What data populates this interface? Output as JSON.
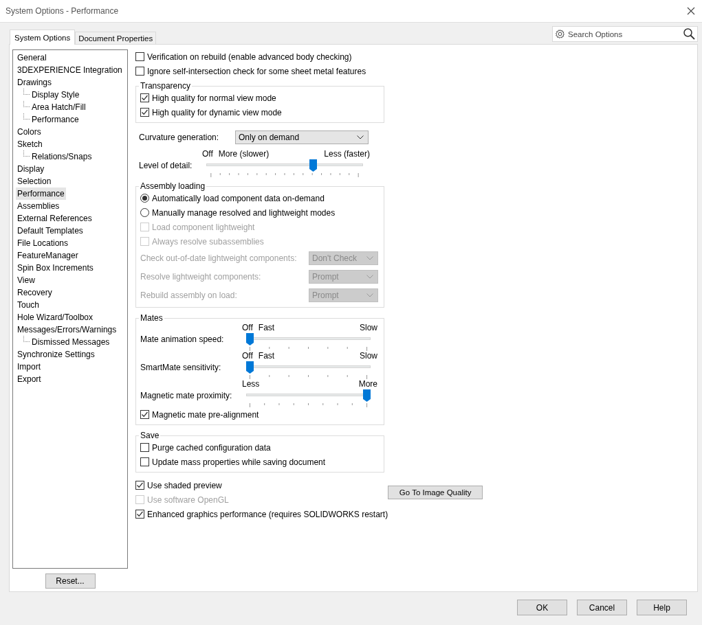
{
  "window": {
    "title": "System Options - Performance"
  },
  "tabs": [
    {
      "label": "System Options",
      "selected": true
    },
    {
      "label": "Document Properties",
      "selected": false
    }
  ],
  "search": {
    "placeholder": "Search Options"
  },
  "sidebar": {
    "items": [
      {
        "label": "General",
        "selected": false
      },
      {
        "label": "3DEXPERIENCE Integration",
        "selected": false
      },
      {
        "label": "Drawings",
        "selected": false,
        "children": [
          {
            "label": "Display Style",
            "selected": false
          },
          {
            "label": "Area Hatch/Fill",
            "selected": false
          },
          {
            "label": "Performance",
            "selected": false
          }
        ]
      },
      {
        "label": "Colors",
        "selected": false
      },
      {
        "label": "Sketch",
        "selected": false,
        "children": [
          {
            "label": "Relations/Snaps",
            "selected": false
          }
        ]
      },
      {
        "label": "Display",
        "selected": false
      },
      {
        "label": "Selection",
        "selected": false
      },
      {
        "label": "Performance",
        "selected": true
      },
      {
        "label": "Assemblies",
        "selected": false
      },
      {
        "label": "External References",
        "selected": false
      },
      {
        "label": "Default Templates",
        "selected": false
      },
      {
        "label": "File Locations",
        "selected": false
      },
      {
        "label": "FeatureManager",
        "selected": false
      },
      {
        "label": "Spin Box Increments",
        "selected": false
      },
      {
        "label": "View",
        "selected": false
      },
      {
        "label": "Recovery",
        "selected": false
      },
      {
        "label": "Touch",
        "selected": false
      },
      {
        "label": "Hole Wizard/Toolbox",
        "selected": false
      },
      {
        "label": "Messages/Errors/Warnings",
        "selected": false,
        "children": [
          {
            "label": "Dismissed Messages",
            "selected": false
          }
        ]
      },
      {
        "label": "Synchronize Settings",
        "selected": false
      },
      {
        "label": "Import",
        "selected": false
      },
      {
        "label": "Export",
        "selected": false
      }
    ],
    "reset_button": "Reset..."
  },
  "content": [
    {
      "kind": "checkbox",
      "label": "Verification on rebuild (enable advanced body checking)",
      "checked": false,
      "disabled": false
    },
    {
      "kind": "checkbox",
      "label": "Ignore self-intersection check for some sheet metal features",
      "checked": false,
      "disabled": false
    },
    {
      "kind": "group",
      "title": "Transparency",
      "items": [
        {
          "kind": "checkbox",
          "label": "High quality for normal view mode",
          "checked": true,
          "disabled": false
        },
        {
          "kind": "checkbox",
          "label": "High quality for dynamic view mode",
          "checked": true,
          "disabled": false
        }
      ]
    },
    {
      "kind": "dropdown",
      "label": "Curvature generation:",
      "value": "Only on demand",
      "disabled": false
    },
    {
      "kind": "slider",
      "label": "Level of detail:",
      "scale": [
        "Off",
        "More (slower)",
        "Less (faster)"
      ],
      "level": 0.69
    },
    {
      "kind": "group",
      "title": "Assembly loading",
      "items": [
        {
          "kind": "radio",
          "label": "Automatically load component data on-demand",
          "selected": true
        },
        {
          "kind": "radio",
          "label": "Manually manage resolved and lightweight modes",
          "selected": false
        },
        {
          "kind": "checkbox",
          "label": "Load component lightweight",
          "checked": false,
          "disabled": true
        },
        {
          "kind": "checkbox",
          "label": "Always resolve subassemblies",
          "checked": false,
          "disabled": true
        },
        {
          "kind": "dropdown",
          "label": "Check out-of-date lightweight components:",
          "value": "Don't Check",
          "disabled": true
        },
        {
          "kind": "dropdown",
          "label": "Resolve lightweight components:",
          "value": "Prompt",
          "disabled": true
        },
        {
          "kind": "dropdown",
          "label": "Rebuild assembly on load:",
          "value": "Prompt",
          "disabled": true
        }
      ]
    },
    {
      "kind": "group",
      "title": "Mates",
      "items": [
        {
          "kind": "slider",
          "label": "Mate animation speed:",
          "scale": [
            "Off",
            "Fast",
            "Slow"
          ],
          "level": 0
        },
        {
          "kind": "slider",
          "label": "SmartMate sensitivity:",
          "scale": [
            "Off",
            "Fast",
            "Slow"
          ],
          "level": 0
        },
        {
          "kind": "slider",
          "label": "Magnetic mate proximity:",
          "scale": [
            "Less",
            "More"
          ],
          "level": 1
        },
        {
          "kind": "checkbox",
          "label": "Magnetic mate pre-alignment",
          "checked": true,
          "disabled": false
        }
      ]
    },
    {
      "kind": "group",
      "title": "Save",
      "items": [
        {
          "kind": "checkbox",
          "label": "Purge cached configuration data",
          "checked": false,
          "disabled": false
        },
        {
          "kind": "checkbox",
          "label": "Update mass properties while saving document",
          "checked": false,
          "disabled": false
        }
      ]
    }
  ],
  "graphics": {
    "checkboxes": [
      {
        "label": "Use shaded preview",
        "checked": true,
        "disabled": false
      },
      {
        "label": "Use software OpenGL",
        "checked": false,
        "disabled": true
      },
      {
        "label": "Enhanced graphics performance (requires SOLIDWORKS restart)",
        "checked": true,
        "disabled": false
      }
    ],
    "button": "Go To Image Quality"
  },
  "buttons": [
    "OK",
    "Cancel",
    "Help"
  ]
}
